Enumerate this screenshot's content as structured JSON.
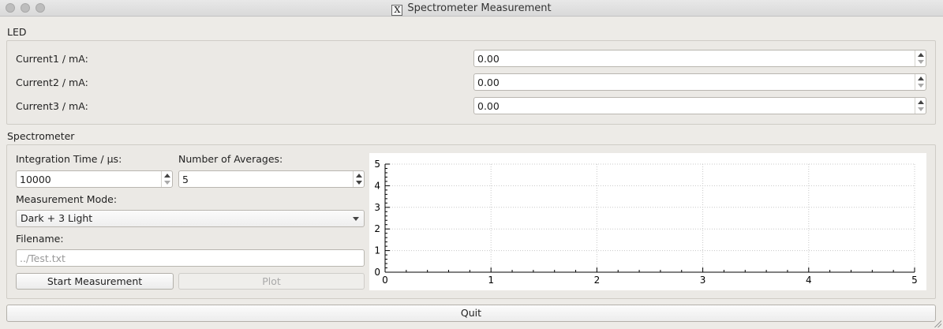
{
  "window": {
    "title": "Spectrometer Measurement",
    "app_icon_glyph": "X"
  },
  "led": {
    "group_title": "LED",
    "fields": [
      {
        "label": "Current1 / mA:",
        "value": "0.00"
      },
      {
        "label": "Current2 / mA:",
        "value": "0.00"
      },
      {
        "label": "Current3 / mA:",
        "value": "0.00"
      }
    ]
  },
  "spectrometer": {
    "group_title": "Spectrometer",
    "integration_label": "Integration Time / µs:",
    "integration_value": "10000",
    "averages_label": "Number of Averages:",
    "averages_value": "5",
    "mode_label": "Measurement Mode:",
    "mode_value": "Dark + 3 Light",
    "filename_label": "Filename:",
    "filename_placeholder": "../Test.txt",
    "start_button": "Start Measurement",
    "plot_button": "Plot"
  },
  "chart_data": {
    "type": "line",
    "x_ticks": [
      "0",
      "1",
      "2",
      "3",
      "4",
      "5"
    ],
    "y_ticks": [
      "0",
      "1",
      "2",
      "3",
      "4",
      "5"
    ],
    "xlim": [
      0,
      5
    ],
    "ylim": [
      0,
      5
    ],
    "grid": true,
    "series": []
  },
  "quit_button": "Quit"
}
